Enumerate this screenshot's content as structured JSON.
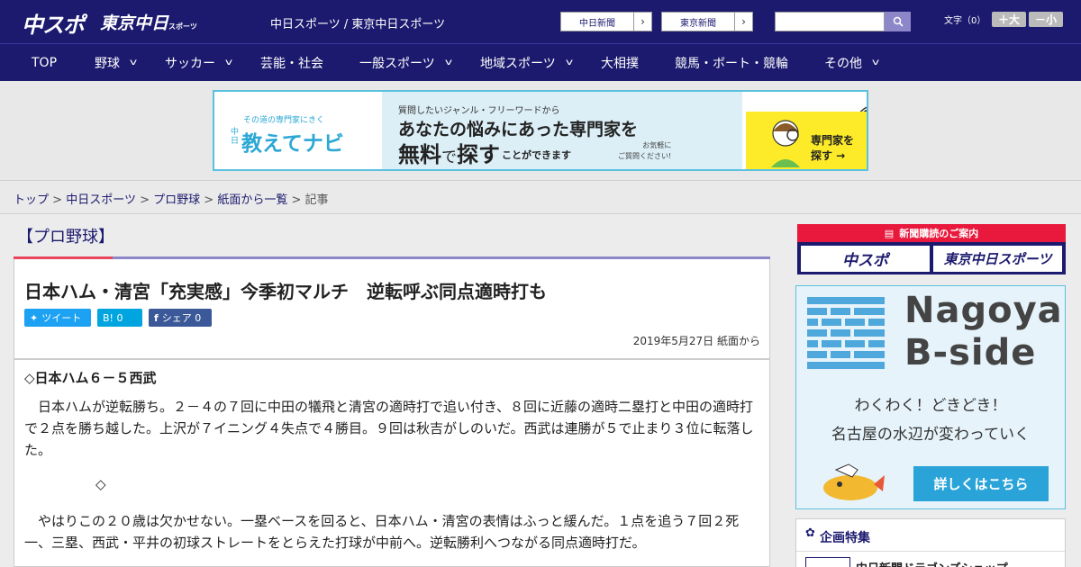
{
  "header": {
    "logo_chuspo": "中スポ",
    "logo_tokyo": "東京中日",
    "logo_tokyo_sub": "スポーツ",
    "site_links": "中日スポーツ / 東京中日スポーツ",
    "paper_buttons": [
      "中日新聞",
      "東京新聞"
    ],
    "search_placeholder": "",
    "font_size_label": "文字（0）",
    "font_bigger": "＋大",
    "font_smaller": "－小"
  },
  "nav": {
    "items": [
      {
        "label": "TOP",
        "dropdown": false
      },
      {
        "label": "野球",
        "dropdown": true
      },
      {
        "label": "サッカー",
        "dropdown": true
      },
      {
        "label": "芸能・社会",
        "dropdown": false
      },
      {
        "label": "一般スポーツ",
        "dropdown": true
      },
      {
        "label": "地域スポーツ",
        "dropdown": true
      },
      {
        "label": "大相撲",
        "dropdown": false
      },
      {
        "label": "競馬・ボート・競輪",
        "dropdown": false
      },
      {
        "label": "その他",
        "dropdown": true
      }
    ]
  },
  "ad_banner": {
    "small_text": "その道の専門家にきく",
    "brand_prefix": "中日",
    "brand": "教えてナビ",
    "line1": "質問したいジャンル・フリーワードから",
    "line2": "あなたの悩みにあった専門家を",
    "line3_bold1": "無料",
    "line3_normal": "で",
    "line3_bold2": "探す",
    "line4": "ことができます",
    "line5a": "お気軽に",
    "line5b": "ご質問ください!",
    "right_text1": "専門家を",
    "right_text2": "探す →"
  },
  "breadcrumb": {
    "items": [
      "トップ",
      "中日スポーツ",
      "プロ野球",
      "紙面から一覧"
    ],
    "current": "記事",
    "separator": ">"
  },
  "article": {
    "category": "【プロ野球】",
    "headline": "日本ハム・清宮「充実感」今季初マルチ　逆転呼ぶ同点適時打も",
    "share": [
      {
        "label": "ツイート",
        "icon": "twitter-icon",
        "color": "#1da1f2"
      },
      {
        "label": "B! 0",
        "icon": "hatena-icon",
        "color": "#00a4de"
      },
      {
        "label": "シェア 0",
        "icon": "facebook-icon",
        "color": "#3b5998"
      }
    ],
    "date": "2019年5月27日 紙面から",
    "lead": "◇日本ハム６－５西武",
    "para1": "　日本ハムが逆転勝ち。２－４の７回に中田の犠飛と清宮の適時打で追い付き、８回に近藤の適時二塁打と中田の適時打で２点を勝ち越した。上沢が７イニング４失点で４勝目。９回は秋吉がしのいだ。西武は連勝が５で止まり３位に転落した。",
    "separator": "◇",
    "para2": "　やはりこの２０歳は欠かせない。一塁ベースを回ると、日本ハム・清宮の表情はふっと緩んだ。１点を追う７回２死一、三塁、西武・平井の初球ストレートをとらえた打球が中前へ。逆転勝利へつながる同点適時打だ。"
  },
  "sidebar": {
    "subscribe_header": "新聞購読のご案内",
    "subscribe_items": [
      "中スポ",
      "東京中日スポーツ"
    ],
    "nagoya_title1": "Nagoya",
    "nagoya_title2": "B-side",
    "nagoya_line1": "わくわく！どきどき！",
    "nagoya_line2": "名古屋の水辺が変わっていく",
    "nagoya_button": "詳しくはこちら",
    "feature_title": "企画特集",
    "feature_item": "中日新聞ドラゴンズショップ"
  },
  "colors": {
    "brand": "#1c1a6e",
    "accent": "#e8193c",
    "link": "#1c1a6e",
    "nb_button": "#2aa3d8"
  }
}
